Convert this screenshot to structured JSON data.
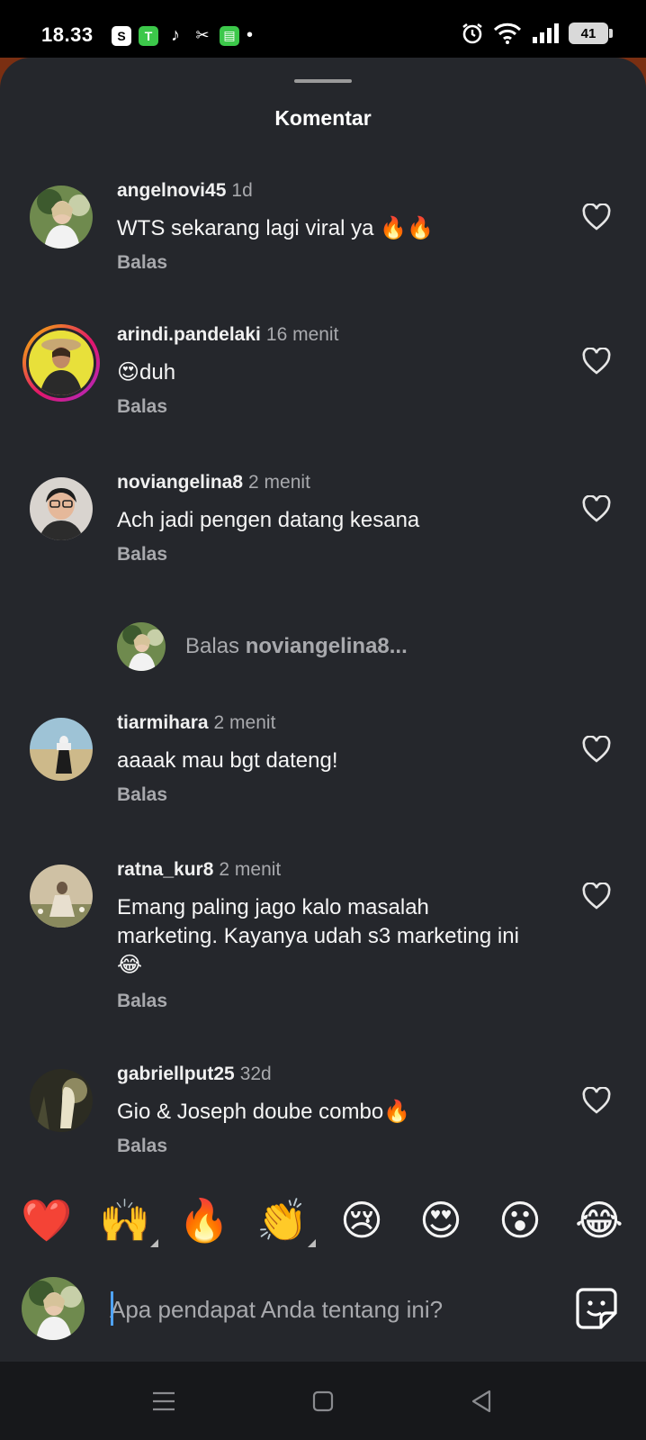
{
  "status_bar": {
    "time": "18.33",
    "dot": "•",
    "battery": "41",
    "app_icons": [
      "shopee-icon",
      "tokopedia-icon",
      "tiktok-icon",
      "capcut-icon",
      "message-icon"
    ],
    "status_icons": [
      "alarm-icon",
      "wifi-icon",
      "signal-icon",
      "battery-icon"
    ]
  },
  "sheet": {
    "title": "Komentar"
  },
  "comments": [
    {
      "username": "angelnovi45",
      "time": "1d",
      "text": "WTS sekarang lagi viral ya 🔥🔥",
      "reply": "Balas"
    },
    {
      "username": "arindi.pandelaki",
      "time": "16 menit",
      "text": "😍duh",
      "reply": "Balas"
    },
    {
      "username": "noviangelina8",
      "time": "2 menit",
      "text": "Ach jadi pengen datang kesana",
      "reply": "Balas"
    },
    {
      "username": "tiarmihara",
      "time": "2 menit",
      "text": "aaaak mau bgt dateng!",
      "reply": "Balas"
    },
    {
      "username": "ratna_kur8",
      "time": "2 menit",
      "text": "Emang paling jago kalo masalah marketing. Kayanya udah s3 marketing ini😂",
      "reply": "Balas"
    },
    {
      "username": "gabriellput25",
      "time": "32d",
      "text": "Gio & Joseph doube combo🔥",
      "reply": "Balas"
    }
  ],
  "reply_prompt": {
    "prefix": "Balas",
    "target": "noviangelina8..."
  },
  "emoji_bar": [
    "❤️",
    "🙌",
    "🔥",
    "👏",
    "😢",
    "😍",
    "😮",
    "😂"
  ],
  "input": {
    "placeholder": "Apa pendapat Anda tentang ini?"
  },
  "nav": [
    "menu-icon",
    "home-icon",
    "back-icon"
  ],
  "colors": {
    "sheet_bg": "#25272c",
    "muted_text": "#a8a9ad",
    "text": "#f5f5f5"
  }
}
